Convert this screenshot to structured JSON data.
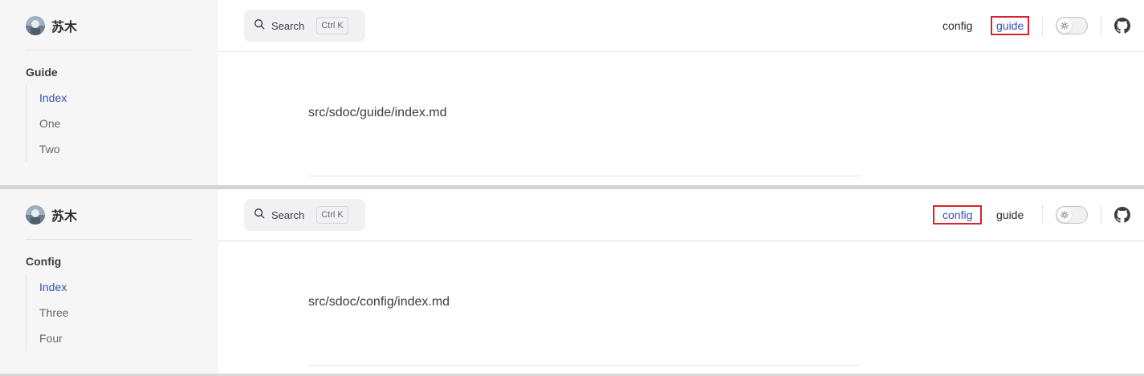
{
  "colors": {
    "accent": "#3451b2",
    "highlight_box": "#d6242a",
    "sidebar_bg": "#f6f6f7"
  },
  "panels": [
    {
      "brand": {
        "name": "苏木",
        "avatar_icon": "avatar-image"
      },
      "search": {
        "label": "Search",
        "shortcut": "Ctrl K",
        "icon": "search-icon"
      },
      "nav": [
        {
          "label": "config",
          "active": false,
          "boxed": false
        },
        {
          "label": "guide",
          "active": true,
          "boxed": true
        }
      ],
      "theme_toggle_icon": "sun-icon",
      "github_icon": "github-icon",
      "sidebar": {
        "group_title": "Guide",
        "items": [
          {
            "label": "Index",
            "active": true
          },
          {
            "label": "One",
            "active": false
          },
          {
            "label": "Two",
            "active": false
          }
        ]
      },
      "content": {
        "path": "src/sdoc/guide/index.md"
      }
    },
    {
      "brand": {
        "name": "苏木",
        "avatar_icon": "avatar-image"
      },
      "search": {
        "label": "Search",
        "shortcut": "Ctrl K",
        "icon": "search-icon"
      },
      "nav": [
        {
          "label": "config",
          "active": true,
          "boxed": true
        },
        {
          "label": "guide",
          "active": false,
          "boxed": false
        }
      ],
      "theme_toggle_icon": "sun-icon",
      "github_icon": "github-icon",
      "sidebar": {
        "group_title": "Config",
        "items": [
          {
            "label": "Index",
            "active": true
          },
          {
            "label": "Three",
            "active": false
          },
          {
            "label": "Four",
            "active": false
          }
        ]
      },
      "content": {
        "path": "src/sdoc/config/index.md"
      }
    }
  ]
}
